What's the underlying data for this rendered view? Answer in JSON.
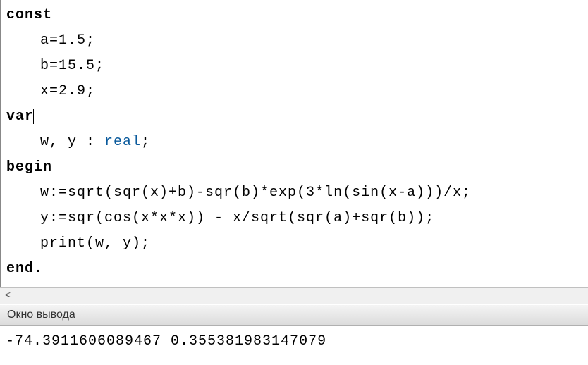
{
  "code": {
    "keywords": {
      "const": "const",
      "var": "var",
      "begin": "begin",
      "end": "end."
    },
    "lines": {
      "const_a": "a=1.5;",
      "const_b": "b=15.5;",
      "const_x": "x=2.9;",
      "var_decl_pre": "w, y : ",
      "var_type": "real",
      "var_decl_post": ";",
      "stmt_w": "w:=sqrt(sqr(x)+b)-sqr(b)*exp(3*ln(sin(x-a)))/x;",
      "stmt_y": "y:=sqr(cos(x*x*x)) - x/sqrt(sqr(a)+sqr(b));",
      "stmt_print": "print(w, y);"
    }
  },
  "scroll": {
    "left_arrow": "<"
  },
  "output": {
    "title": "Окно вывода",
    "result": "-74.3911606089467 0.355381983147079"
  }
}
